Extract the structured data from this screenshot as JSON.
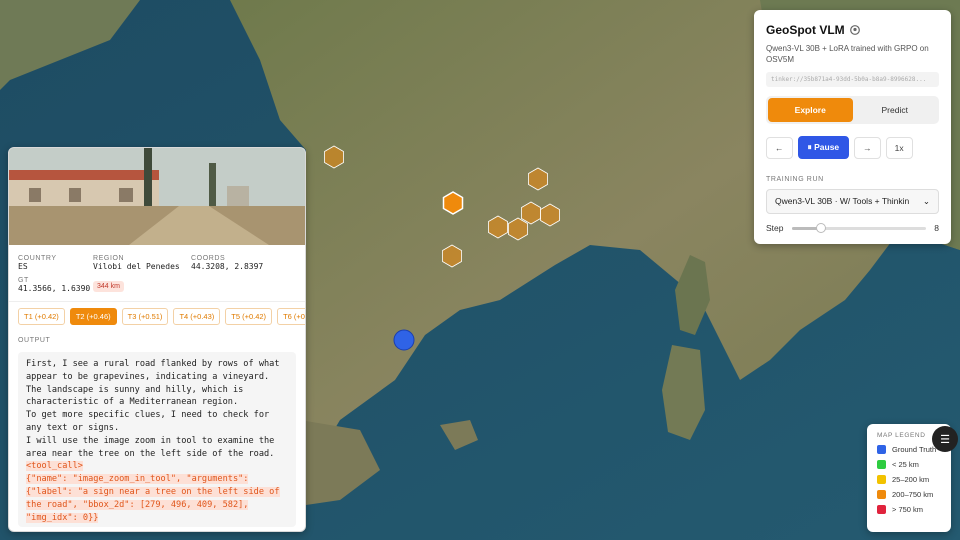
{
  "map": {
    "markers": [
      {
        "kind": "guess",
        "turn": "T1",
        "color": "#ef8a0c"
      },
      {
        "kind": "guess",
        "turn": "T2",
        "color": "#ef8a0c",
        "selected": true
      },
      {
        "kind": "guess",
        "turn": "T3",
        "color": "#ef8a0c"
      },
      {
        "kind": "guess",
        "turn": "T4",
        "color": "#ef8a0c"
      },
      {
        "kind": "guess",
        "turn": "T5",
        "color": "#ef8a0c"
      },
      {
        "kind": "guess",
        "turn": "T6",
        "color": "#ef8a0c"
      },
      {
        "kind": "guess",
        "turn": "T7",
        "color": "#ef8a0c"
      },
      {
        "kind": "guess",
        "turn": "T8",
        "color": "#ef8a0c"
      },
      {
        "kind": "ground-truth",
        "color": "#2f63e6"
      }
    ],
    "cursor_icon": "arrow-cursor-icon"
  },
  "sample": {
    "country_label": "COUNTRY",
    "country": "ES",
    "region_label": "REGION",
    "region": "Vilobi del Penedes",
    "coords_label": "COORDS",
    "coords": "44.3208, 2.8397",
    "gt_label": "GT",
    "gt": "41.3566, 1.6390",
    "distance": "344 km"
  },
  "turns": [
    {
      "label": "T1 (+0.42)",
      "active": false
    },
    {
      "label": "T2 (+0.46)",
      "active": true
    },
    {
      "label": "T3 (+0.51)",
      "active": false
    },
    {
      "label": "T4 (+0.43)",
      "active": false
    },
    {
      "label": "T5 (+0.42)",
      "active": false
    },
    {
      "label": "T6 (+0",
      "active": false
    }
  ],
  "output": {
    "label": "OUTPUT",
    "lines": [
      {
        "text": "First, I see a rural road flanked by rows of what",
        "tool": false
      },
      {
        "text": "appear to be grapevines, indicating a vineyard.",
        "tool": false
      },
      {
        "text": "The landscape is sunny and hilly, which is",
        "tool": false
      },
      {
        "text": "characteristic of a Mediterranean region.",
        "tool": false
      },
      {
        "text": "To get more specific clues, I need to check for",
        "tool": false
      },
      {
        "text": "any text or signs.",
        "tool": false
      },
      {
        "text": "I will use the image zoom in tool to examine the",
        "tool": false
      },
      {
        "text": "area near the tree on the left side of the road.",
        "tool": false
      },
      {
        "text": "<tool_call>",
        "tool": true
      },
      {
        "text": "{\"name\": \"image_zoom_in_tool\", \"arguments\":",
        "tool": true
      },
      {
        "text": "{\"label\": \"a sign near a tree on the left side of",
        "tool": true
      },
      {
        "text": "the road\", \"bbox_2d\": [279, 496, 409, 582],",
        "tool": true
      },
      {
        "text": "\"img_idx\": 0}}",
        "tool": true
      }
    ]
  },
  "app": {
    "title": "GeoSpot VLM",
    "title_icon": "github-icon",
    "subtitle": "Qwen3-VL 30B + LoRA trained with GRPO on OSV5M",
    "run_id": "tinker://35b871a4-93dd-5b0a-b8a9-8996628...",
    "tabs": [
      {
        "label": "Explore",
        "active": true
      },
      {
        "label": "Predict",
        "active": false
      }
    ],
    "controls": {
      "prev": "←",
      "pause": "⏸ Pause",
      "next": "→",
      "speed": "1x"
    },
    "training_run_label": "TRAINING RUN",
    "training_run_value": "Qwen3-VL 30B · W/ Tools + Thinkin",
    "step_label": "Step",
    "step_value": "8",
    "step_fraction": 0.22
  },
  "legend": {
    "title": "MAP LEGEND",
    "toggle_icon": "legend-toggle-icon",
    "items": [
      {
        "label": "Ground Truth",
        "color": "#2f63e6"
      },
      {
        "label": "< 25 km",
        "color": "#2ecc40"
      },
      {
        "label": "25–200 km",
        "color": "#f2c200"
      },
      {
        "label": "200–750 km",
        "color": "#ef8a0c"
      },
      {
        "label": "> 750 km",
        "color": "#e0233d"
      }
    ]
  }
}
